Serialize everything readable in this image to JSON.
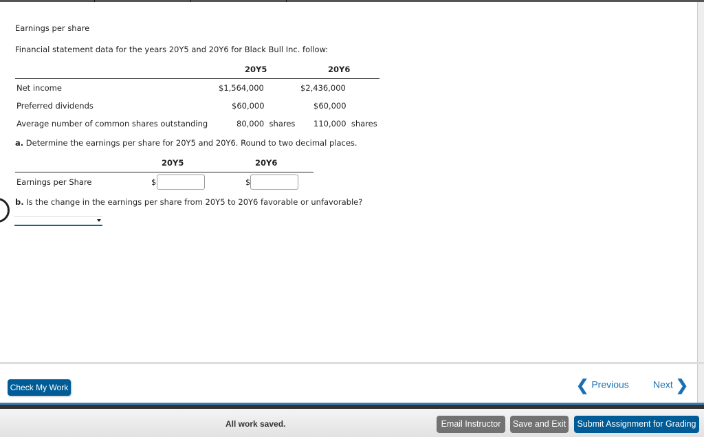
{
  "page": {
    "title": "Earnings per share",
    "intro": "Financial statement data for the years 20Y5 and 20Y6 for Black Bull Inc. follow:"
  },
  "data_table": {
    "columns": [
      "20Y5",
      "20Y6"
    ],
    "rows": [
      {
        "label": "Net income",
        "values": [
          "$1,564,000",
          "$2,436,000"
        ]
      },
      {
        "label": "Preferred dividends",
        "values": [
          "$60,000",
          "$60,000"
        ]
      },
      {
        "label": "Average number of common shares outstanding",
        "values": [
          "80,000  shares",
          "110,000  shares"
        ]
      }
    ]
  },
  "part_a": {
    "letter": "a.",
    "question": " Determine the earnings per share for 20Y5 and 20Y6. Round to two decimal places.",
    "columns": [
      "20Y5",
      "20Y6"
    ],
    "row_label": "Earnings per Share",
    "currency": "$",
    "inputs": [
      {
        "value": ""
      },
      {
        "value": ""
      }
    ]
  },
  "part_b": {
    "letter": "b.",
    "question": " Is the change in the earnings per share from 20Y5 to 20Y6 favorable or unfavorable?",
    "select_value": ""
  },
  "nav": {
    "check_label": "Check My Work",
    "previous_label": "Previous",
    "next_label": "Next",
    "prev_icon": "chevron-left",
    "next_icon": "chevron-right"
  },
  "footer": {
    "status": "All work saved.",
    "email_label": "Email Instructor",
    "save_exit_label": "Save and Exit",
    "submit_label": "Submit Assignment for Grading"
  },
  "colors": {
    "primary": "#005c97",
    "link": "#1a6fb5",
    "secondary_button": "#727272"
  }
}
